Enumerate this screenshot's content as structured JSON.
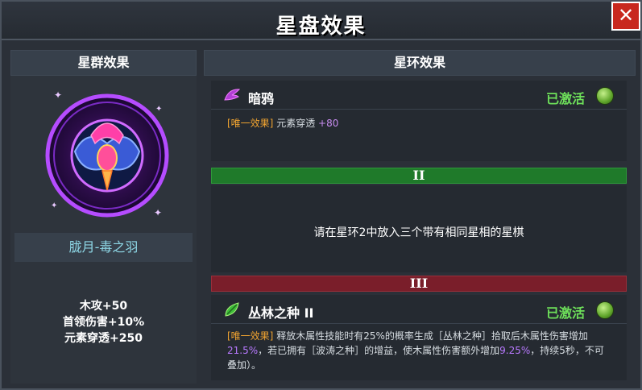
{
  "window": {
    "title": "星盘效果",
    "close_label": "✕"
  },
  "left_panel": {
    "header": "星群效果",
    "emblem_icon": "poison-raven-emblem-icon",
    "name": "胧月-毒之羽",
    "stats": [
      "木攻+50",
      "首领伤害+10%",
      "元素穿透+250"
    ]
  },
  "right_panel": {
    "header": "星环效果",
    "ring1": {
      "name": "暗鸦",
      "icon": "raven-feather-icon",
      "status": "已激活",
      "effect_tag": "[唯一效果]",
      "effect_text": "元素穿透",
      "effect_value": "+80"
    },
    "ring2": {
      "bar_label": "II",
      "prompt": "请在星环2中放入三个带有相同星相的星棋"
    },
    "ring3": {
      "bar_label": "III",
      "name": "丛林之种 II",
      "icon": "jungle-seed-icon",
      "status": "已激活",
      "effect_tag": "[唯一效果]",
      "effect_part1": "释放木属性技能时有25%的概率生成［丛林之种］拾取后木属性伤害增加",
      "effect_val1": "21.5%",
      "effect_part2": "，若已拥有［波涛之种］的增益，使木属性伤害额外增加",
      "effect_val2": "9.25%",
      "effect_part3": "，持续5秒，不可叠加）。"
    }
  },
  "colors": {
    "active_green": "#6ee05a",
    "tag_orange": "#f0a330",
    "value_purple": "#b879ff",
    "bar_green": "#1f7a2a",
    "bar_red": "#7a1e2a",
    "close_red": "#c8281e"
  }
}
